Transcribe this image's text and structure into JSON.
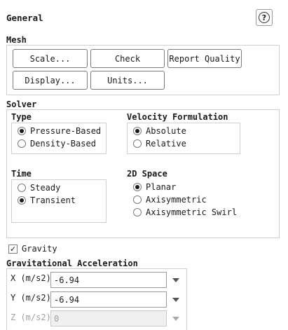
{
  "panel": {
    "title": "General",
    "help_icon": "help-icon",
    "help_glyph": "?"
  },
  "mesh": {
    "label": "Mesh",
    "buttons": [
      "Scale...",
      "Check",
      "Report Quality",
      "Display...",
      "Units..."
    ]
  },
  "solver": {
    "label": "Solver",
    "type": {
      "label": "Type",
      "options": [
        "Pressure-Based",
        "Density-Based"
      ],
      "selected": "Pressure-Based"
    },
    "velocity": {
      "label": "Velocity Formulation",
      "options": [
        "Absolute",
        "Relative"
      ],
      "selected": "Absolute"
    },
    "time": {
      "label": "Time",
      "options": [
        "Steady",
        "Transient"
      ],
      "selected": "Transient"
    },
    "space": {
      "label": "2D Space",
      "options": [
        "Planar",
        "Axisymmetric",
        "Axisymmetric Swirl"
      ],
      "selected": "Planar"
    }
  },
  "gravity": {
    "label": "Gravity",
    "checked": true,
    "check_glyph": "✓"
  },
  "acceleration": {
    "label": "Gravitational Acceleration",
    "x": {
      "label": "X (m/s2)",
      "value": "-6.94",
      "enabled": true
    },
    "y": {
      "label": "Y (m/s2)",
      "value": "-6.94",
      "enabled": true
    },
    "z": {
      "label": "Z (m/s2)",
      "value": "0",
      "enabled": false
    }
  },
  "colors": {
    "border": "#d0d0d0",
    "disabled_text": "#a0a0a0"
  }
}
